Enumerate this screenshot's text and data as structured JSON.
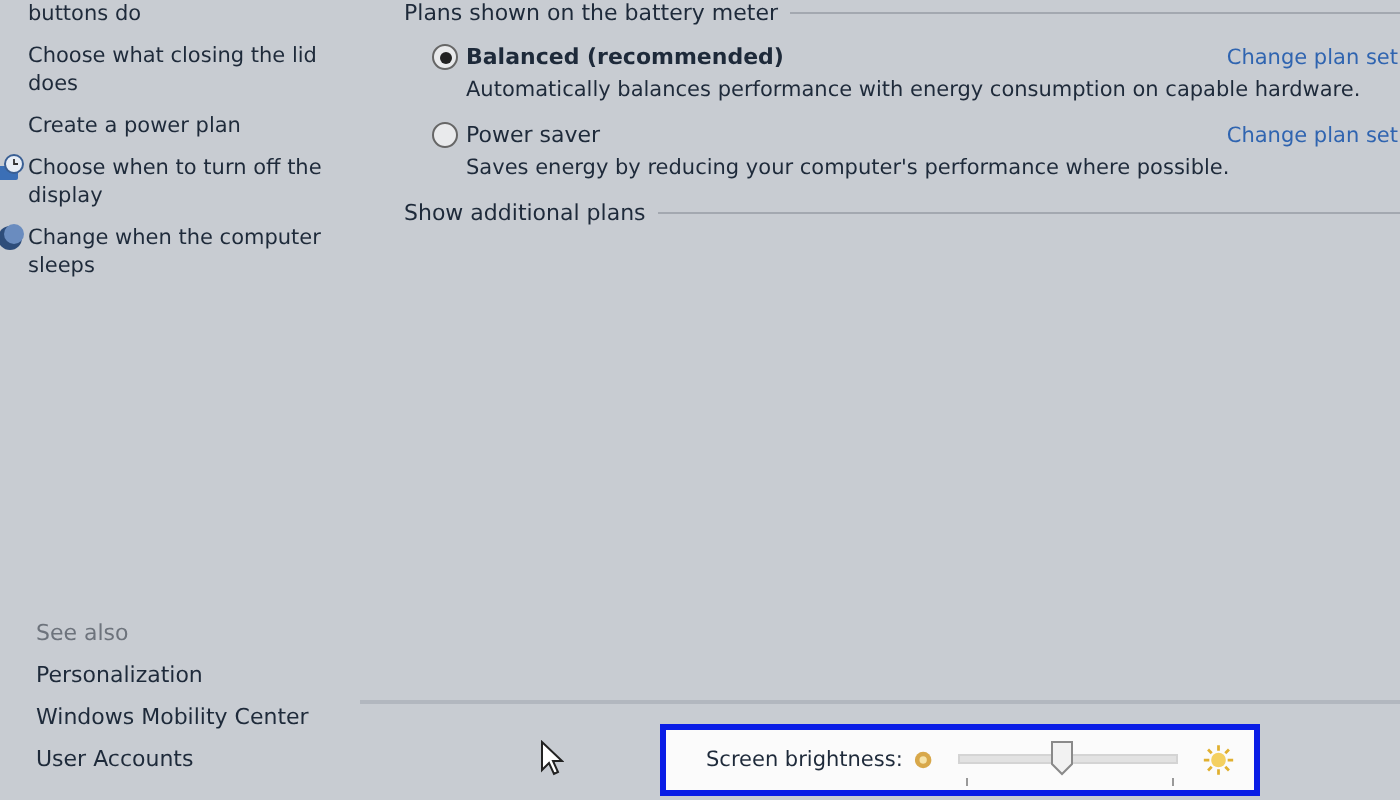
{
  "sidebar": {
    "tasks": [
      {
        "label": "buttons do",
        "kind": "plain"
      },
      {
        "label": "Choose what closing the lid does",
        "kind": "plain"
      },
      {
        "label": "Create a power plan",
        "kind": "plain"
      },
      {
        "label": "Choose when to turn off the display",
        "kind": "display"
      },
      {
        "label": "Change when the computer sleeps",
        "kind": "sleep"
      }
    ],
    "see_also": {
      "heading": "See also",
      "links": [
        "Personalization",
        "Windows Mobility Center",
        "User Accounts"
      ]
    }
  },
  "plans": {
    "heading": "Plans shown on the battery meter",
    "items": [
      {
        "name": "Balanced (recommended)",
        "description": "Automatically balances performance with energy consumption on capable hardware.",
        "link": "Change plan set",
        "selected": true
      },
      {
        "name": "Power saver",
        "description": "Saves energy by reducing your computer's performance where possible.",
        "link": "Change plan set",
        "selected": false
      }
    ],
    "more": "Show additional plans"
  },
  "brightness": {
    "label": "Screen brightness:",
    "level": 0.48
  }
}
